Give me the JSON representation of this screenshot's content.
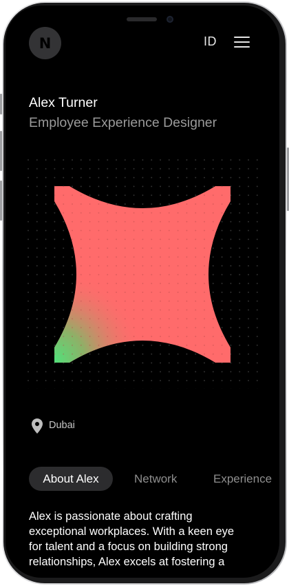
{
  "header": {
    "logo_letter": "N",
    "language": "ID"
  },
  "profile": {
    "name": "Alex Turner",
    "role": "Employee Experience Designer",
    "location": "Dubai"
  },
  "tabs": [
    {
      "label": "About Alex",
      "active": true
    },
    {
      "label": "Network",
      "active": false
    },
    {
      "label": "Experience",
      "active": false
    }
  ],
  "bio": {
    "lines": [
      "Alex is passionate about crafting",
      "exceptional workplaces. With a keen eye",
      "for talent and a focus on building strong",
      "relationships, Alex excels at fostering a"
    ]
  },
  "colors": {
    "background": "#000000",
    "shape_primary": "#ff6b6b",
    "shape_accent": "#52e07a",
    "tab_active_bg": "#2c2c2e",
    "text_muted": "#9a9a9a"
  },
  "icons": {
    "menu": "hamburger-menu-icon",
    "location": "location-pin-icon"
  }
}
